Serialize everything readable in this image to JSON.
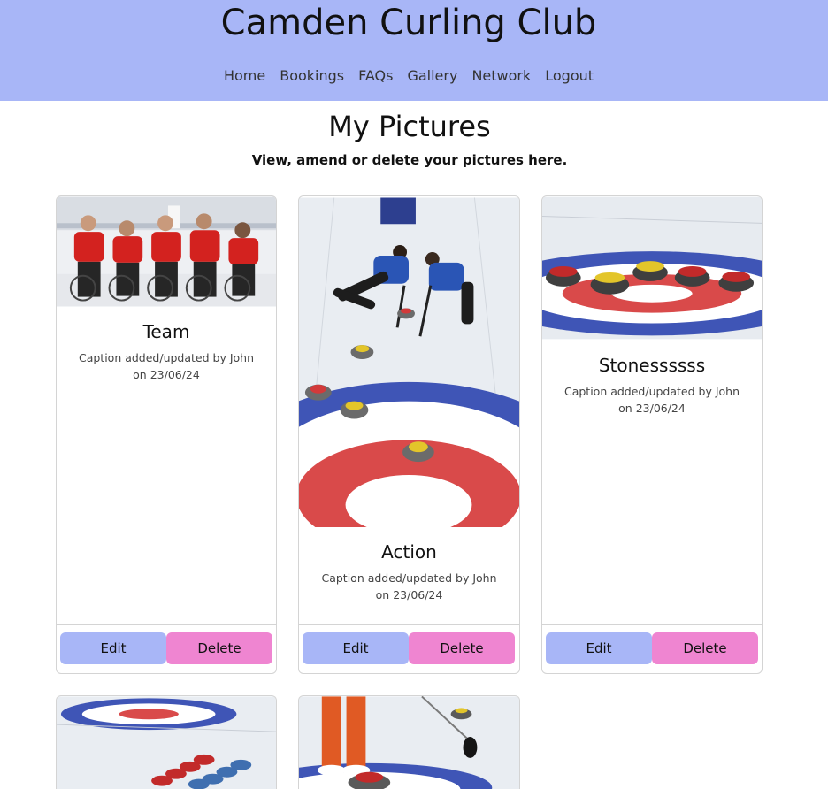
{
  "site": {
    "title": "Camden Curling Club"
  },
  "nav": [
    "Home",
    "Bookings",
    "FAQs",
    "Gallery",
    "Network",
    "Logout"
  ],
  "page": {
    "title": "My Pictures",
    "subtitle": "View, amend or delete your pictures here."
  },
  "cards": [
    {
      "title": "Team",
      "caption_line1": "Caption added/updated by John",
      "caption_line2": "on 23/06/24",
      "edit_label": "Edit",
      "delete_label": "Delete"
    },
    {
      "title": "Action",
      "caption_line1": "Caption added/updated by John",
      "caption_line2": "on 23/06/24",
      "edit_label": "Edit",
      "delete_label": "Delete"
    },
    {
      "title": "Stonessssss",
      "caption_line1": "Caption added/updated by John",
      "caption_line2": "on 23/06/24",
      "edit_label": "Edit",
      "delete_label": "Delete"
    }
  ],
  "colors": {
    "header": "#a8b6f7",
    "edit_button": "#a8b6f7",
    "delete_button": "#ef85d1",
    "jacket_red": "#d3221f",
    "house_blue": "#3f55b6",
    "house_red": "#d94a4a"
  }
}
